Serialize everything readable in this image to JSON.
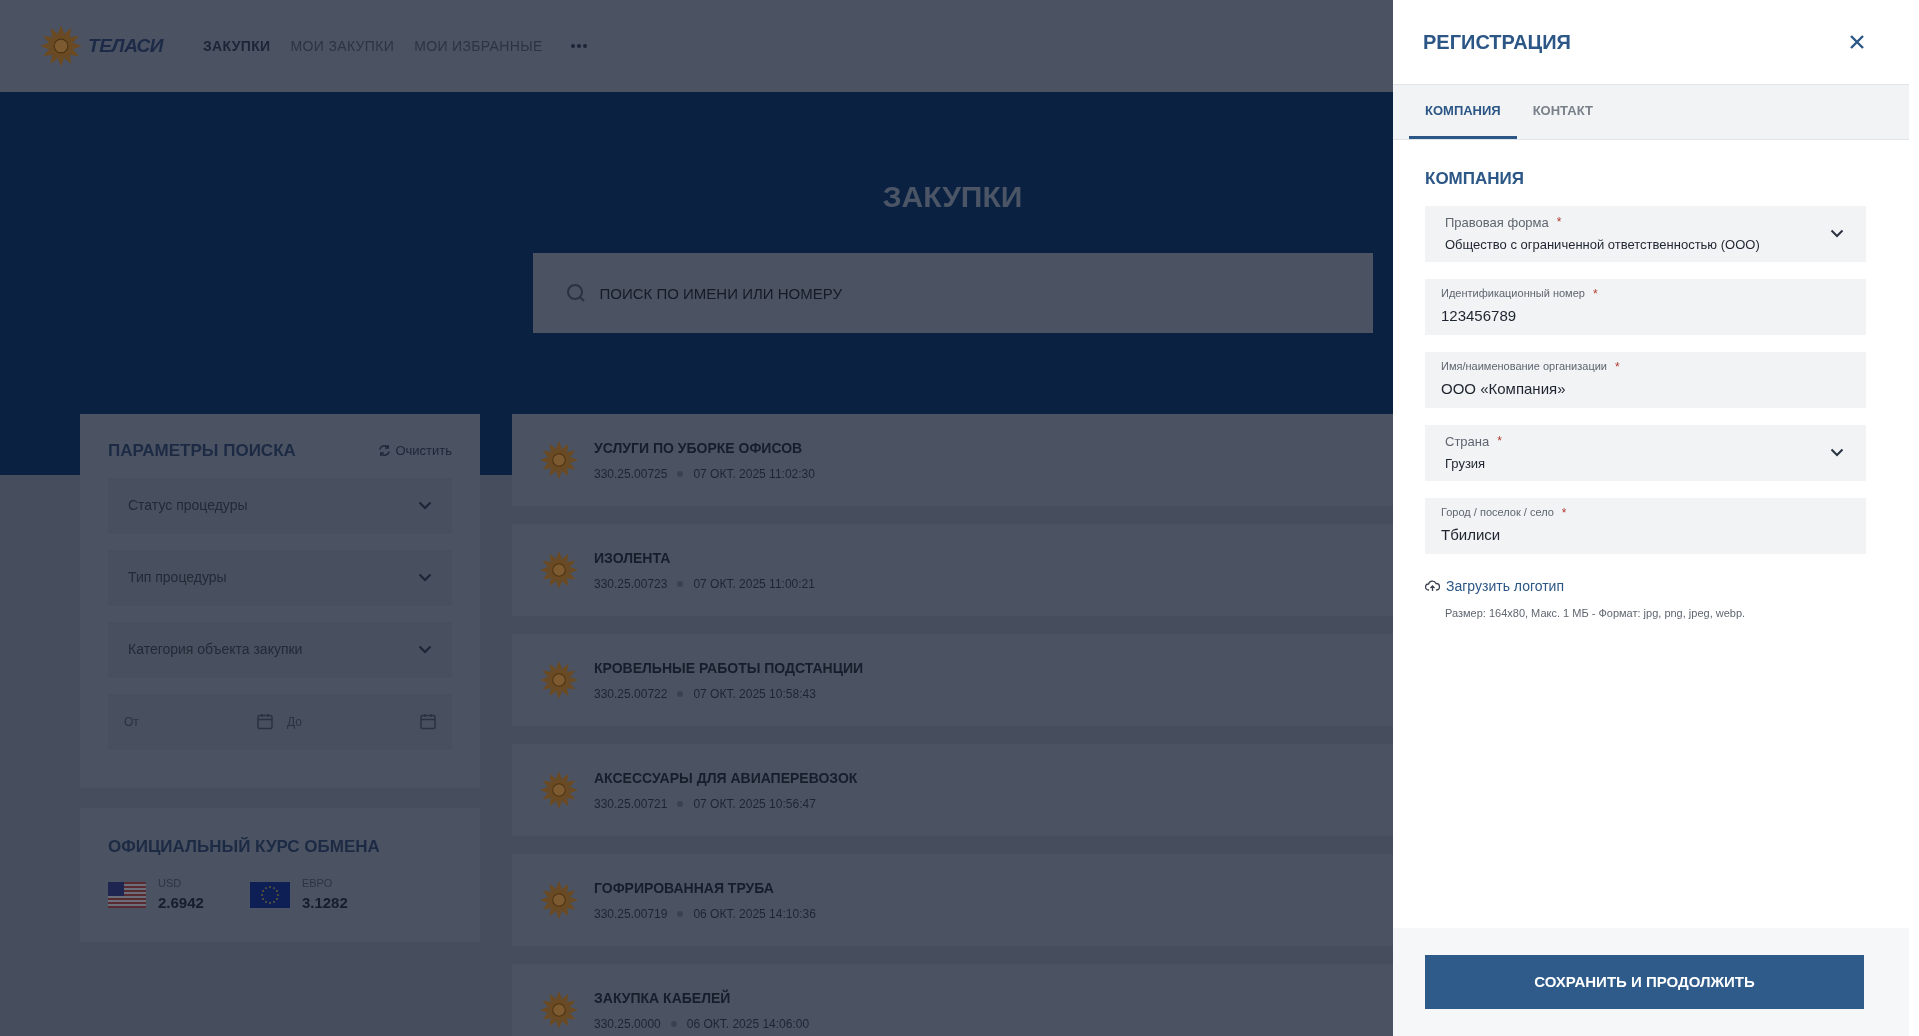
{
  "header": {
    "logo_text": "ТЕЛАСИ",
    "nav": [
      {
        "label": "ЗАКУПКИ",
        "selected": true
      },
      {
        "label": "МОИ ЗАКУПКИ",
        "selected": false
      },
      {
        "label": "МОИ ИЗБРАННЫЕ",
        "selected": false
      }
    ]
  },
  "hero": {
    "title": "ЗАКУПКИ",
    "search": {
      "placeholder": "ПОИСК ПО ИМЕНИ ИЛИ НОМЕРУ"
    }
  },
  "filters": {
    "title": "ПАРАМЕТРЫ ПОИСКА",
    "clear": "Очистить",
    "selects": [
      {
        "placeholder": "Статус процедуры"
      },
      {
        "placeholder": "Тип процедуры"
      },
      {
        "placeholder": "Категория объекта закупки"
      }
    ],
    "date_from": {
      "placeholder": "От"
    },
    "date_to": {
      "placeholder": "До"
    }
  },
  "exchange": {
    "title": "ОФИЦИАЛЬНЫЙ КУРС ОБМЕНА",
    "rates": [
      {
        "kind": "usd",
        "currency": "USD",
        "value": "2.6942"
      },
      {
        "kind": "eur",
        "currency": "ЕВРО",
        "value": "3.1282"
      }
    ]
  },
  "tenders": [
    {
      "title": "УСЛУГИ ПО УБОРКЕ ОФИСОВ",
      "number": "330.25.00725",
      "date": "07 ОКТ. 2025 11:02:30"
    },
    {
      "title": "ИЗОЛЕНТА",
      "number": "330.25.00723",
      "date": "07 ОКТ. 2025 11:00:21"
    },
    {
      "title": "КРОВЕЛЬНЫЕ РАБОТЫ ПОДСТАНЦИИ",
      "number": "330.25.00722",
      "date": "07 ОКТ. 2025 10:58:43"
    },
    {
      "title": "АКСЕССУАРЫ ДЛЯ АВИАПЕРЕВОЗОК",
      "number": "330.25.00721",
      "date": "07 ОКТ. 2025 10:56:47"
    },
    {
      "title": "ГОФРИРОВАННАЯ ТРУБА",
      "number": "330.25.00719",
      "date": "06 ОКТ. 2025 14:10:36"
    },
    {
      "title": "ЗАКУПКА КАБЕЛЕЙ",
      "number": "330.25.0000",
      "date": "06 ОКТ. 2025 14:06:00"
    }
  ],
  "drawer": {
    "title": "РЕГИСТРАЦИЯ",
    "tabs": [
      {
        "label": "КОМПАНИЯ",
        "selected": true
      },
      {
        "label": "КОНТАКТ",
        "selected": false
      }
    ],
    "section_title": "КОМПАНИЯ",
    "fields": [
      {
        "kind": "select",
        "label": "Правовая форма",
        "mark": "*",
        "value": "Общество с ограниченной ответственностью (ООО)"
      },
      {
        "kind": "text",
        "label": "Идентификационный номер",
        "mark": "*",
        "value": "123456789"
      },
      {
        "kind": "text",
        "label": "Имя/наименование организации",
        "mark": "*",
        "value": "ООО «Компания»"
      },
      {
        "kind": "select",
        "label": "Страна",
        "mark": "*",
        "value": "Грузия"
      },
      {
        "kind": "text",
        "label": "Город / поселок / село",
        "mark": "*",
        "value": "Тбилиси"
      }
    ],
    "upload": {
      "label": "Загрузить логотип",
      "hint": "Размер: 164x80, Макс. 1 МБ - Формат: jpg, png, jpeg, webp."
    },
    "submit": "СОХРАНИТЬ И ПРОДОЛЖИТЬ"
  }
}
